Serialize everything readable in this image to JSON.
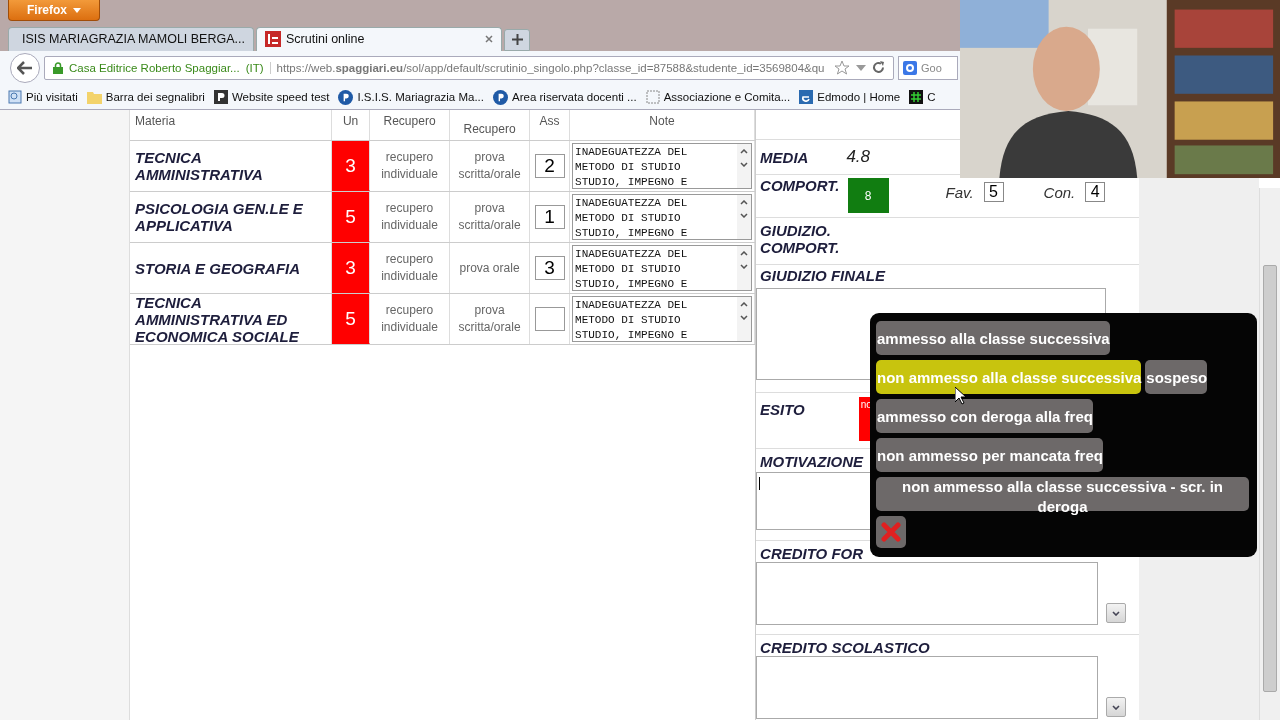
{
  "browser": {
    "menu_button": "Firefox",
    "tabs": [
      {
        "title": "ISIS MARIAGRAZIA MAMOLI BERGA...",
        "selected": false,
        "kind": "p"
      },
      {
        "title": "Scrutini online",
        "selected": true,
        "kind": "is"
      }
    ],
    "site_identity": "Casa Editrice Roberto Spaggiar...",
    "site_country": "(IT)",
    "url": "https://web.**spaggiari.eu**/sol/app/default/scrutinio_singolo.php?classe_id=87588&studente_id=3569804&qu",
    "search_placeholder": "Goo",
    "bookmarks": [
      {
        "label": "Più visitati",
        "kind": "page"
      },
      {
        "label": "Barra dei segnalibri",
        "kind": "folder"
      },
      {
        "label": "Website speed test",
        "kind": "square"
      },
      {
        "label": "I.S.I.S. Mariagrazia Ma...",
        "kind": "p"
      },
      {
        "label": "Area riservata docenti ...",
        "kind": "p"
      },
      {
        "label": "Associazione e Comita...",
        "kind": "blank"
      },
      {
        "label": "Edmodo | Home",
        "kind": "e"
      },
      {
        "label": "C",
        "kind": "hash"
      }
    ]
  },
  "table": {
    "columns": [
      "Materia",
      "Un",
      "Recupero",
      "Recupero",
      "Ass",
      "Note"
    ],
    "rows": [
      {
        "subject": "TECNICA AMMINISTRATIVA",
        "grade": "3",
        "recovery": "recupero individuale",
        "recovery_type": "prova scritta/orale",
        "absences": "2",
        "note": "INADEGUATEZZA DEL\nMETODO DI STUDIO\nSTUDIO, IMPEGNO E"
      },
      {
        "subject": "PSICOLOGIA GEN.LE E APPLICATIVA",
        "grade": "5",
        "recovery": "recupero individuale",
        "recovery_type": "prova scritta/orale",
        "absences": "1",
        "note": "INADEGUATEZZA DEL\nMETODO DI STUDIO\nSTUDIO, IMPEGNO E"
      },
      {
        "subject": "STORIA E GEOGRAFIA",
        "grade": "3",
        "recovery": "recupero individuale",
        "recovery_type": "prova orale",
        "absences": "3",
        "note": "INADEGUATEZZA DEL\nMETODO DI STUDIO\nSTUDIO, IMPEGNO E"
      },
      {
        "subject": "TECNICA AMMINISTRATIVA ED ECONOMICA SOCIALE",
        "grade": "5",
        "recovery": "recupero individuale",
        "recovery_type": "prova scritta/orale",
        "note": "INADEGUATEZZA DEL\nMETODO DI STUDIO\nSTUDIO, IMPEGNO E"
      }
    ]
  },
  "summary": {
    "media_label": "MEDIA",
    "media": "4.8",
    "conduct_label": "COMPORT.",
    "conduct_grade": "8",
    "fav_label": "Fav.",
    "fav": "5",
    "con_label": "Con.",
    "con": "4",
    "conduct_judgement_label": "GIUDIZIO. COMPORT.",
    "final_judgement_label": "GIUDIZIO FINALE",
    "outcome_label": "ESITO",
    "outcome_badge": "no",
    "motivation_label": "MOTIVAZIONE",
    "formative_credit_label": "CREDITO FOR",
    "school_credit_label": "CREDITO SCOLASTICO"
  },
  "outcome_menu": {
    "rows": [
      {
        "options": [
          {
            "label": "ammesso alla classe successiva",
            "selected": false
          }
        ]
      },
      {
        "options": [
          {
            "label": "non ammesso alla classe successiva",
            "selected": true
          },
          {
            "label": "sospeso",
            "selected": false
          }
        ]
      },
      {
        "options": [
          {
            "label": "ammesso con deroga alla freq",
            "selected": false
          }
        ]
      },
      {
        "options": [
          {
            "label": "non ammesso per mancata freq",
            "selected": false
          }
        ]
      },
      {
        "options": [
          {
            "label": "non ammesso alla classe successiva - scr. in deroga",
            "selected": false
          }
        ]
      }
    ]
  }
}
